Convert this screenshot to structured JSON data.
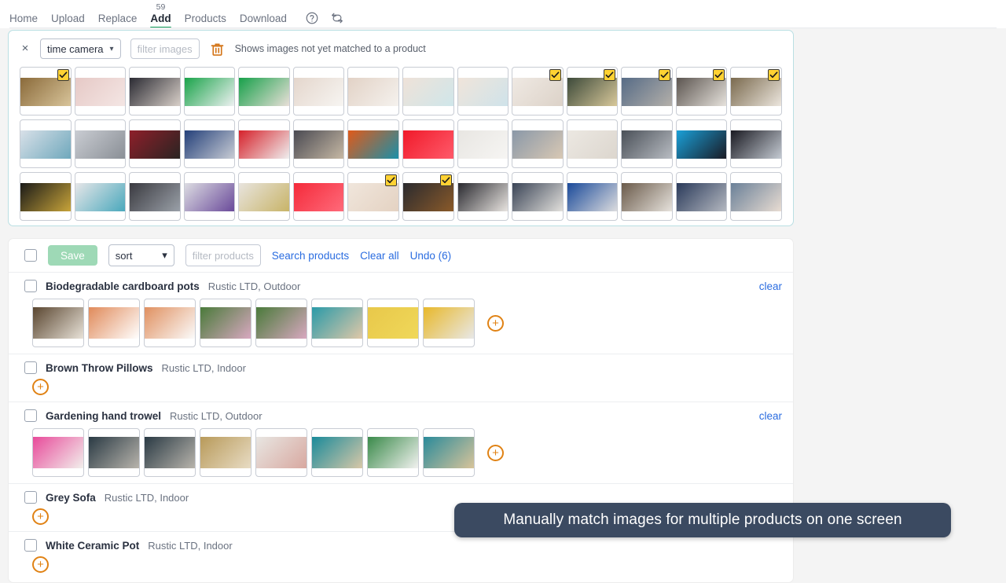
{
  "nav": {
    "items": [
      {
        "label": "Home",
        "active": false
      },
      {
        "label": "Upload",
        "active": false
      },
      {
        "label": "Replace",
        "active": false
      },
      {
        "label": "Add",
        "active": true,
        "badge": "59"
      },
      {
        "label": "Products",
        "active": false
      },
      {
        "label": "Download",
        "active": false
      }
    ],
    "help_icon": "help-circle-icon",
    "refresh_icon": "refresh-sync-icon"
  },
  "filter_panel": {
    "close_label": "×",
    "source_select": "time camera",
    "filter_placeholder": "filter images",
    "trash_icon": "trash-icon",
    "hint": "Shows images not yet matched to a product",
    "thumbnails": [
      {
        "checked": true,
        "c1": "#8a6a3a",
        "c2": "#d8c49a"
      },
      {
        "checked": false,
        "c1": "#e6c9c6",
        "c2": "#f4e6e4"
      },
      {
        "checked": false,
        "c1": "#2b2b33",
        "c2": "#d8cfc8"
      },
      {
        "checked": false,
        "c1": "#1aa34a",
        "c2": "#eef1f2"
      },
      {
        "checked": false,
        "c1": "#17a04a",
        "c2": "#e9dfd8"
      },
      {
        "checked": false,
        "c1": "#e4d6cc",
        "c2": "#f7f5f2"
      },
      {
        "checked": false,
        "c1": "#e2d2c6",
        "c2": "#f5f2ee"
      },
      {
        "checked": false,
        "c1": "#efe2d8",
        "c2": "#cfe6ea"
      },
      {
        "checked": false,
        "c1": "#f0e4da",
        "c2": "#cfe3ea"
      },
      {
        "checked": true,
        "c1": "#efe9e3",
        "c2": "#dcd2c8"
      },
      {
        "checked": true,
        "c1": "#3d4a3a",
        "c2": "#d8c89a"
      },
      {
        "checked": true,
        "c1": "#566b86",
        "c2": "#b4b0aa"
      },
      {
        "checked": true,
        "c1": "#5c5550",
        "c2": "#e6e2dc"
      },
      {
        "checked": true,
        "c1": "#7a6a4e",
        "c2": "#ece6de"
      },
      {
        "checked": false,
        "c1": "#d8e0e8",
        "c2": "#6fa8bc"
      },
      {
        "checked": false,
        "c1": "#c9ccd2",
        "c2": "#8a8f96"
      },
      {
        "checked": false,
        "c1": "#8e1f2a",
        "c2": "#2a2422"
      },
      {
        "checked": false,
        "c1": "#24407a",
        "c2": "#c8ccd4"
      },
      {
        "checked": false,
        "c1": "#d6212a",
        "c2": "#efefef"
      },
      {
        "checked": false,
        "c1": "#4a4a52",
        "c2": "#c6b8a4"
      },
      {
        "checked": false,
        "c1": "#e05a1a",
        "c2": "#1a8fa8"
      },
      {
        "checked": false,
        "c1": "#f01a2a",
        "c2": "#ff5a6a"
      },
      {
        "checked": false,
        "c1": "#e8e6e2",
        "c2": "#f6f5f3"
      },
      {
        "checked": false,
        "c1": "#8a98a8",
        "c2": "#d8c8b4"
      },
      {
        "checked": false,
        "c1": "#ece8e2",
        "c2": "#dcd6ce"
      },
      {
        "checked": false,
        "c1": "#4a5058",
        "c2": "#b8bcc2"
      },
      {
        "checked": false,
        "c1": "#1aa0d8",
        "c2": "#1a1a24"
      },
      {
        "checked": false,
        "c1": "#1a1a22",
        "c2": "#c4cad2"
      },
      {
        "checked": false,
        "c1": "#1a1a18",
        "c2": "#c8a43a"
      },
      {
        "checked": false,
        "c1": "#e6e6e8",
        "c2": "#4aa8bc"
      },
      {
        "checked": false,
        "c1": "#3a3a40",
        "c2": "#9aa0a8"
      },
      {
        "checked": false,
        "c1": "#dcdce2",
        "c2": "#6a4a9a"
      },
      {
        "checked": false,
        "c1": "#e8e4de",
        "c2": "#c8b468"
      },
      {
        "checked": false,
        "c1": "#f42a3a",
        "c2": "#ff6a7a"
      },
      {
        "checked": true,
        "c1": "#f0e6dc",
        "c2": "#e4d2c2"
      },
      {
        "checked": true,
        "c1": "#2a2a2e",
        "c2": "#8a5a2a"
      },
      {
        "checked": false,
        "c1": "#2a2a30",
        "c2": "#e8e4e0"
      },
      {
        "checked": false,
        "c1": "#3a4456",
        "c2": "#e2e0dc"
      },
      {
        "checked": false,
        "c1": "#1a4a9a",
        "c2": "#dcdcde"
      },
      {
        "checked": false,
        "c1": "#6a5a4a",
        "c2": "#e6e2dc"
      },
      {
        "checked": false,
        "c1": "#2a3a5a",
        "c2": "#b4b8c0"
      },
      {
        "checked": false,
        "c1": "#6a8098",
        "c2": "#e8dcd2"
      }
    ]
  },
  "products": {
    "toolbar": {
      "save_label": "Save",
      "sort_label": "sort",
      "filter_placeholder": "filter products",
      "search_label": "Search products",
      "clear_all_label": "Clear all",
      "undo_label": "Undo (6)"
    },
    "clear_label": "clear",
    "rows": [
      {
        "title": "Biodegradable cardboard pots",
        "subtitle": "Rustic LTD, Outdoor",
        "has_clear": true,
        "thumbnails": [
          {
            "c1": "#5a4630",
            "c2": "#e8e2d8"
          },
          {
            "c1": "#e08a5a",
            "c2": "#ffffff"
          },
          {
            "c1": "#e09060",
            "c2": "#fbfbfb"
          },
          {
            "c1": "#4a7a3a",
            "c2": "#d8a8c0"
          },
          {
            "c1": "#4a7a3a",
            "c2": "#d8a8c0"
          },
          {
            "c1": "#2a9aa8",
            "c2": "#e0c8a8"
          },
          {
            "c1": "#e8c84a",
            "c2": "#f0d85a"
          },
          {
            "c1": "#e8b82a",
            "c2": "#e8e8e8"
          }
        ]
      },
      {
        "title": "Brown Throw Pillows",
        "subtitle": "Rustic LTD, Indoor",
        "has_clear": false,
        "thumbnails": []
      },
      {
        "title": "Gardening hand trowel",
        "subtitle": "Rustic LTD, Outdoor",
        "has_clear": true,
        "thumbnails": [
          {
            "c1": "#e84a9a",
            "c2": "#f2f0ec"
          },
          {
            "c1": "#2a3a44",
            "c2": "#b8b4ac"
          },
          {
            "c1": "#2a3a44",
            "c2": "#b8b4ac"
          },
          {
            "c1": "#b89a5a",
            "c2": "#e8dcc4"
          },
          {
            "c1": "#e8e6e2",
            "c2": "#d8a8a0"
          },
          {
            "c1": "#1a8a9a",
            "c2": "#d8c8a8"
          },
          {
            "c1": "#3a8a4a",
            "c2": "#f2f2f0"
          },
          {
            "c1": "#2a8a9a",
            "c2": "#d8c49a"
          }
        ]
      },
      {
        "title": "Grey Sofa",
        "subtitle": "Rustic LTD, Indoor",
        "has_clear": false,
        "thumbnails": []
      },
      {
        "title": "White Ceramic Pot",
        "subtitle": "Rustic LTD, Indoor",
        "has_clear": false,
        "thumbnails": []
      }
    ]
  },
  "banner": {
    "text": "Manually match images for multiple products on one screen",
    "color": "#3b4a61"
  }
}
